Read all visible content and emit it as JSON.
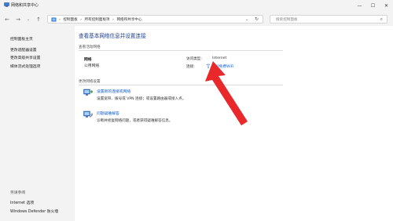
{
  "window": {
    "title": "网络和共享中心"
  },
  "nav": {
    "crumbs": [
      "控制面板",
      "所有控制面板项",
      "网络和共享中心"
    ],
    "separator": "›",
    "search_placeholder": "搜索控制面板"
  },
  "sidebar": {
    "items": [
      "控制面板主页",
      "更改适配器设置",
      "更改高级共享设置",
      "媒体流式处理选项"
    ],
    "see_also_title": "另请参阅",
    "see_also": [
      "Internet 选项",
      "Windows Defender 防火墙"
    ]
  },
  "main": {
    "title": "查看基本网络信息并设置连接",
    "active_label": "查看活动网络",
    "network_name": "网络",
    "network_type": "公用网络",
    "access_type_label": "访问类型:",
    "access_type_value": "Internet",
    "connection_label": "连接:",
    "connection_value": "360免费WiFi",
    "change_label": "更改网络设置",
    "tasks": [
      {
        "link": "设置新的连接或网络",
        "desc": "设置宽带、拨号或 VPN 连接；或设置路由器或接入点。"
      },
      {
        "link": "问题疑难解答",
        "desc": "诊断并修复网络问题，或者获得疑难解答信息。"
      }
    ]
  },
  "colors": {
    "accent": "#1a3c8c",
    "link": "#0b5cd5",
    "arrow": "#e8282b"
  }
}
